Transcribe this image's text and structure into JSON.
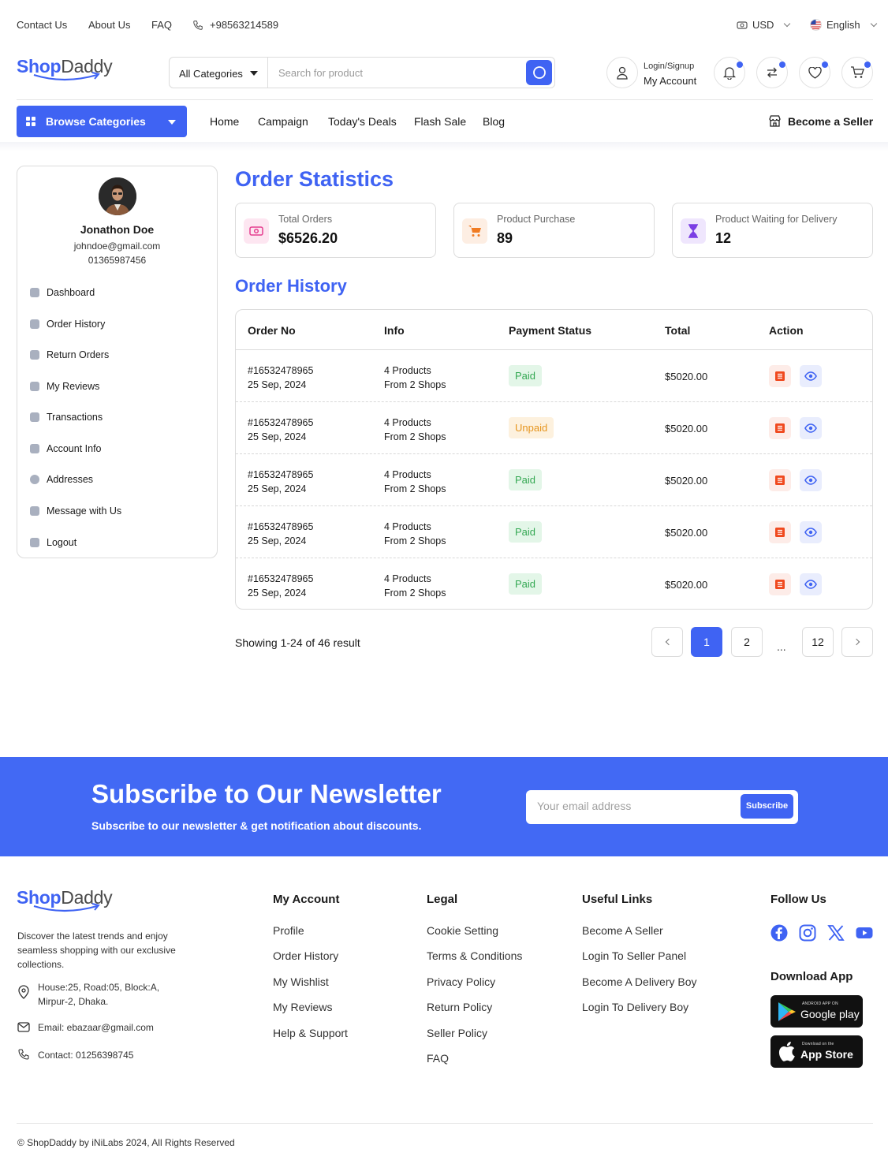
{
  "topbar": {
    "contact": "Contact Us",
    "about": "About Us",
    "faq": "FAQ",
    "phone": "+98563214589",
    "currency": "USD",
    "language": "English"
  },
  "header": {
    "logo_shop": "Shop",
    "logo_daddy": "Daddy",
    "category_select": "All Categories",
    "search_placeholder": "Search for product",
    "login_signup": "Login/Signup",
    "my_account": "My Account"
  },
  "nav": {
    "browse": "Browse Categories",
    "links": [
      "Home",
      "Campaign",
      "Today's Deals",
      "Flash Sale",
      "Blog"
    ],
    "become_seller": "Become a Seller"
  },
  "profile": {
    "name": "Jonathon Doe",
    "email": "johndoe@gmail.com",
    "phone": "01365987456",
    "menu": [
      "Dashboard",
      "Order History",
      "Return Orders",
      "My Reviews",
      "Transactions",
      "Account Info",
      "Addresses",
      "Message with Us",
      "Logout"
    ]
  },
  "stats": {
    "title": "Order Statistics",
    "items": [
      {
        "label": "Total Orders",
        "value": "$6526.20"
      },
      {
        "label": "Product Purchase",
        "value": "89"
      },
      {
        "label": "Product Waiting for Delivery",
        "value": "12"
      }
    ]
  },
  "history": {
    "title": "Order History",
    "columns": [
      "Order No",
      "Info",
      "Payment Status",
      "Total",
      "Action"
    ],
    "rows": [
      {
        "order": "#16532478965",
        "date": "25 Sep, 2024",
        "products": "4 Products",
        "shops": "From 2 Shops",
        "status": "Paid",
        "total": "$5020.00"
      },
      {
        "order": "#16532478965",
        "date": "25 Sep, 2024",
        "products": "4 Products",
        "shops": "From 2 Shops",
        "status": "Unpaid",
        "total": "$5020.00"
      },
      {
        "order": "#16532478965",
        "date": "25 Sep, 2024",
        "products": "4 Products",
        "shops": "From 2 Shops",
        "status": "Paid",
        "total": "$5020.00"
      },
      {
        "order": "#16532478965",
        "date": "25 Sep, 2024",
        "products": "4 Products",
        "shops": "From 2 Shops",
        "status": "Paid",
        "total": "$5020.00"
      },
      {
        "order": "#16532478965",
        "date": "25 Sep, 2024",
        "products": "4 Products",
        "shops": "From 2 Shops",
        "status": "Paid",
        "total": "$5020.00"
      }
    ]
  },
  "pagination": {
    "showing": "Showing 1-24 of 46 result",
    "pages": [
      "1",
      "2",
      "...",
      "12"
    ],
    "current": "1"
  },
  "newsletter": {
    "title": "Subscribe to Our Newsletter",
    "subtitle": "Subscribe to our newsletter & get notification about discounts.",
    "placeholder": "Your email address",
    "button": "Subscribe"
  },
  "footer": {
    "description": "Discover the latest trends and enjoy seamless shopping with our exclusive collections.",
    "address": "House:25, Road:05, Block:A, Mirpur-2, Dhaka.",
    "email": "Email: ebazaar@gmail.com",
    "contact": "Contact: 01256398745",
    "my_account": {
      "title": "My Account",
      "links": [
        "Profile",
        "Order History",
        "My Wishlist",
        "My Reviews",
        "Help & Support"
      ]
    },
    "legal": {
      "title": "Legal",
      "links": [
        "Cookie Setting",
        "Terms & Conditions",
        "Privacy Policy",
        "Return Policy",
        "Seller Policy",
        "FAQ"
      ]
    },
    "useful": {
      "title": "Useful Links",
      "links": [
        "Become A Seller",
        "Login To Seller Panel",
        "Become A Delivery Boy",
        "Login To Delivery Boy"
      ]
    },
    "follow": "Follow Us",
    "social_icons": [
      "facebook-icon",
      "instagram-icon",
      "x-icon",
      "youtube-icon"
    ],
    "download": "Download App",
    "google_small": "ANDROID APP ON",
    "google_big": "Google play",
    "apple_small": "Download on the",
    "apple_big": "App Store",
    "copyright": "© ShopDaddy by iNiLabs 2024, All Rights Reserved"
  },
  "colors": {
    "accent": "#3f63f3",
    "paid": "#34a853",
    "unpaid": "#e6951e",
    "newsletter_bg": "#4269f4"
  }
}
